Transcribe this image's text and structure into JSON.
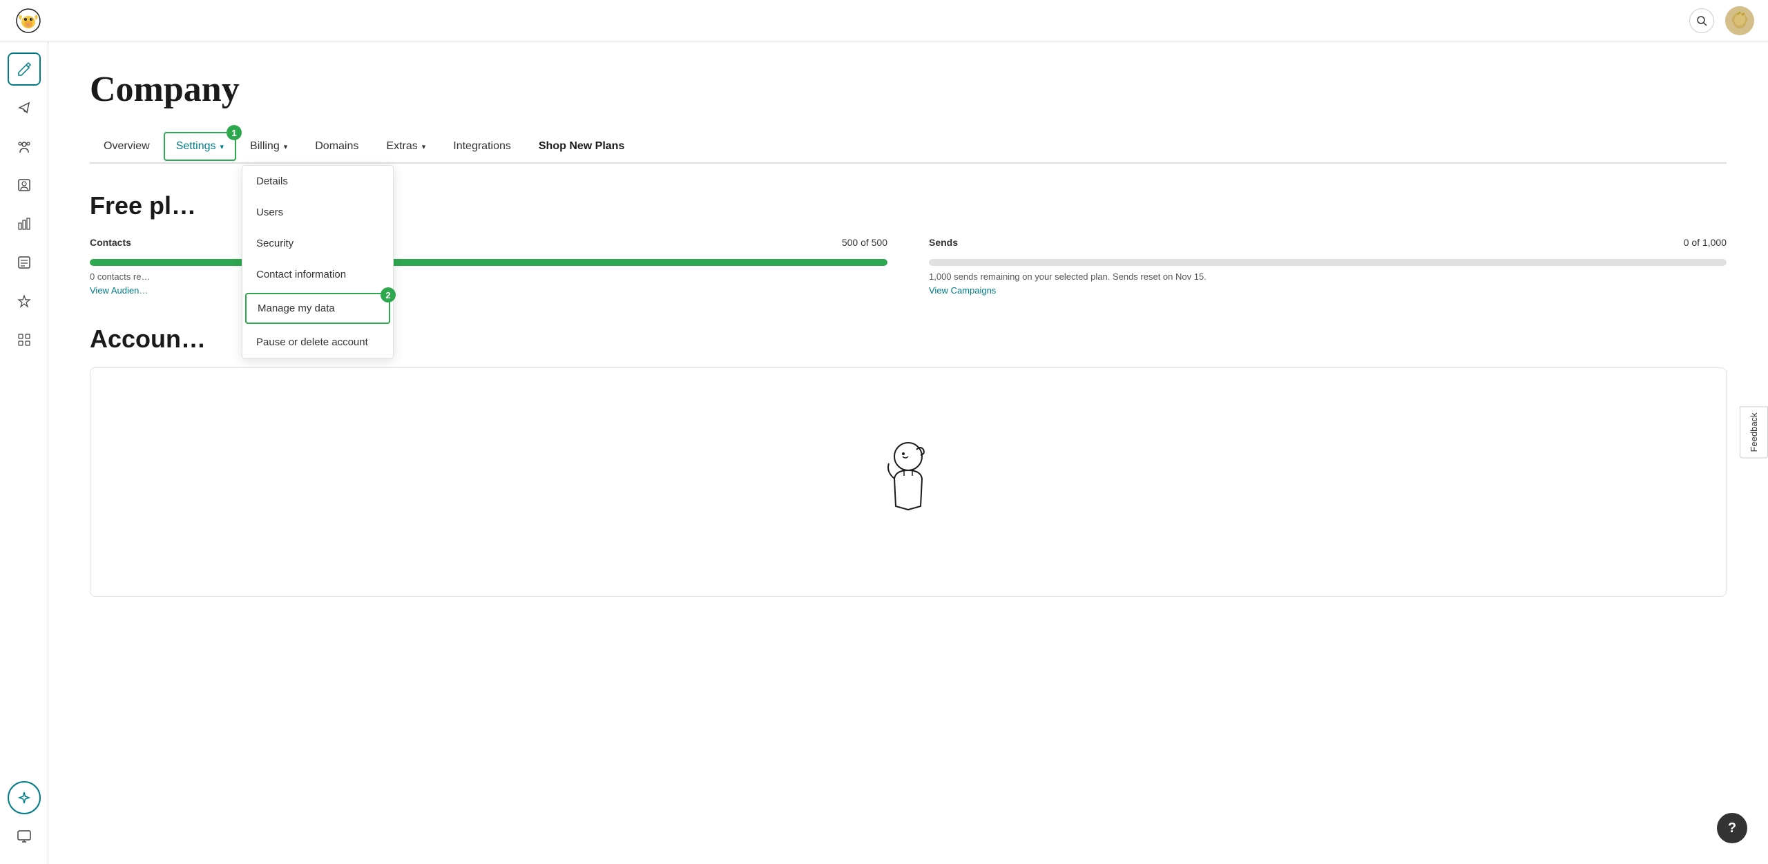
{
  "app": {
    "title": "Mailchimp"
  },
  "topbar": {
    "search_label": "Search",
    "avatar_label": "User avatar"
  },
  "sidebar": {
    "items": [
      {
        "id": "edit",
        "icon": "✏️",
        "label": "Edit",
        "active": true
      },
      {
        "id": "campaigns",
        "icon": "📣",
        "label": "Campaigns",
        "active": false
      },
      {
        "id": "audience",
        "icon": "👥",
        "label": "Audience",
        "active": false
      },
      {
        "id": "contacts",
        "icon": "👤",
        "label": "Contacts",
        "active": false
      },
      {
        "id": "reports",
        "icon": "📊",
        "label": "Reports",
        "active": false
      },
      {
        "id": "content",
        "icon": "📋",
        "label": "Content",
        "active": false
      },
      {
        "id": "automations",
        "icon": "⚡",
        "label": "Automations",
        "active": false
      },
      {
        "id": "apps",
        "icon": "⊞",
        "label": "Apps",
        "active": false
      }
    ],
    "bottom_items": [
      {
        "id": "sparkle",
        "icon": "✦",
        "label": "AI Features"
      },
      {
        "id": "monitor",
        "icon": "⬜",
        "label": "Monitor"
      }
    ]
  },
  "page": {
    "title": "Company"
  },
  "tabs": [
    {
      "id": "overview",
      "label": "Overview",
      "active": false
    },
    {
      "id": "settings",
      "label": "Settings",
      "active": true,
      "badge": "1",
      "has_dropdown": true
    },
    {
      "id": "billing",
      "label": "Billing",
      "active": false,
      "has_chevron": true
    },
    {
      "id": "domains",
      "label": "Domains",
      "active": false
    },
    {
      "id": "extras",
      "label": "Extras",
      "active": false,
      "has_chevron": true
    },
    {
      "id": "integrations",
      "label": "Integrations",
      "active": false
    },
    {
      "id": "shop-new-plans",
      "label": "Shop New Plans",
      "active": false
    }
  ],
  "settings_dropdown": {
    "items": [
      {
        "id": "details",
        "label": "Details"
      },
      {
        "id": "users",
        "label": "Users"
      },
      {
        "id": "security",
        "label": "Security"
      },
      {
        "id": "contact-info",
        "label": "Contact information"
      },
      {
        "id": "manage-data",
        "label": "Manage my data",
        "highlighted": true,
        "badge": "2"
      },
      {
        "id": "pause-delete",
        "label": "Pause or delete account"
      }
    ]
  },
  "plan": {
    "title": "Free pl",
    "contacts_label": "Contacts",
    "contacts_current": "500",
    "contacts_max": "500",
    "contacts_text": "500 of 500",
    "contacts_sub": "0 contacts re",
    "contacts_link": "View Audien",
    "contacts_progress": 100,
    "sends_label": "Sends",
    "sends_current": "0",
    "sends_max": "1,000",
    "sends_text": "0 of 1,000",
    "sends_sub": "1,000 sends remaining on your selected plan. Sends reset on Nov 15.",
    "sends_link": "View Campaigns",
    "sends_progress": 0
  },
  "account": {
    "title": "Accoun"
  },
  "feedback": {
    "label": "Feedback"
  },
  "help": {
    "label": "?"
  }
}
